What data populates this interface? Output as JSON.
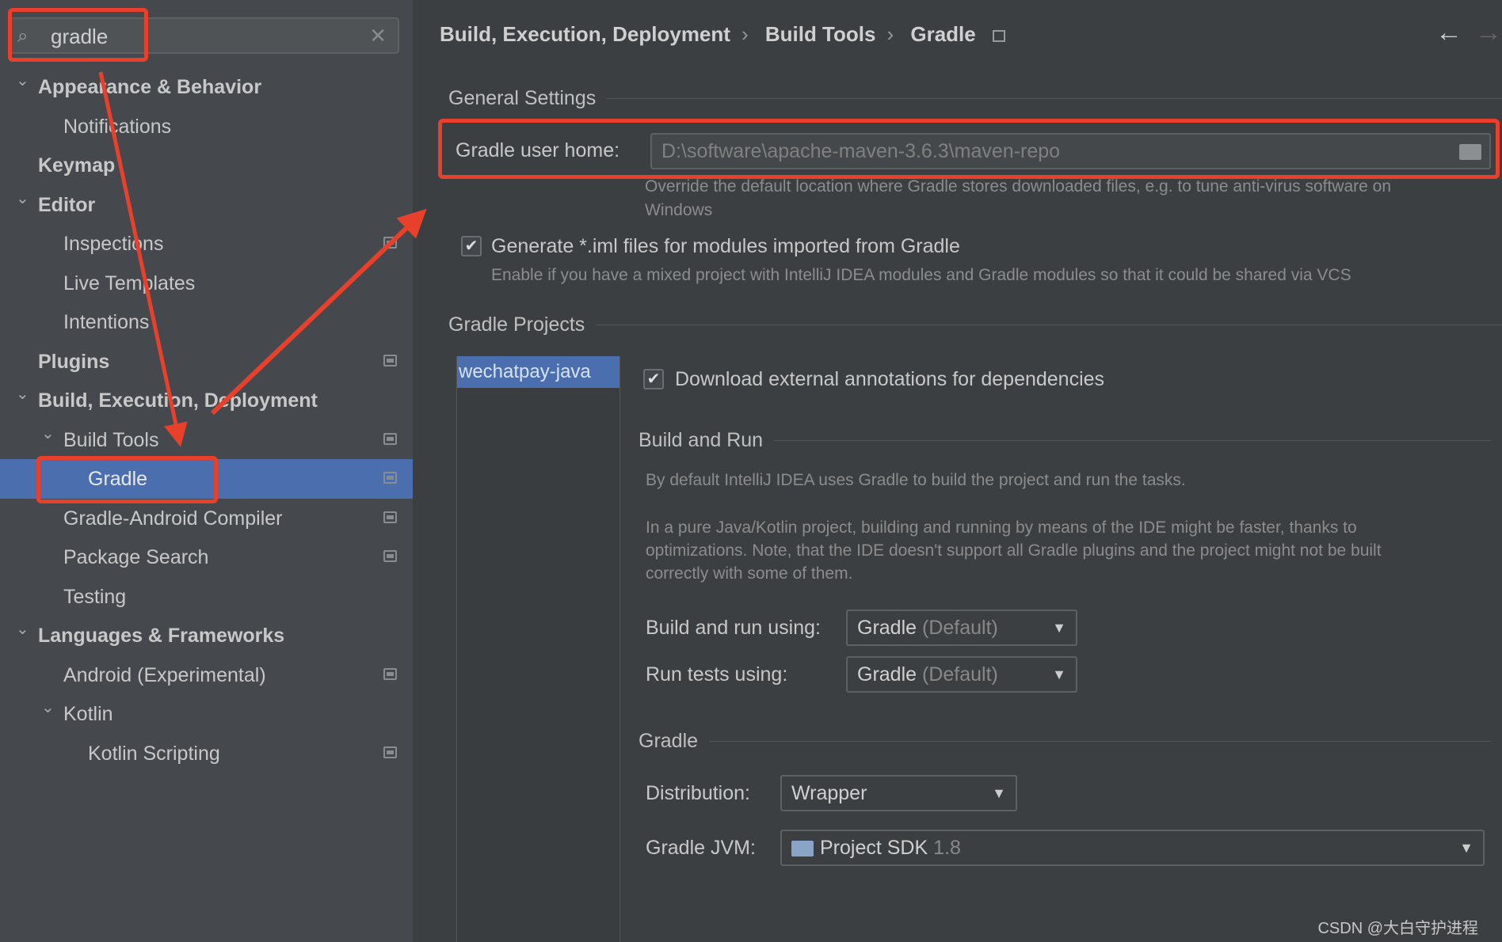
{
  "search": {
    "value": "gradle",
    "icon": "search-icon",
    "clear": "clear-icon"
  },
  "tree": [
    {
      "label": "Appearance & Behavior",
      "level": 0,
      "bold": true,
      "expanded": true
    },
    {
      "label": "Notifications",
      "level": 1
    },
    {
      "label": "Keymap",
      "level": 0,
      "bold": true
    },
    {
      "label": "Editor",
      "level": 0,
      "bold": true,
      "expanded": true
    },
    {
      "label": "Inspections",
      "level": 1,
      "cfg": true
    },
    {
      "label": "Live Templates",
      "level": 1
    },
    {
      "label": "Intentions",
      "level": 1
    },
    {
      "label": "Plugins",
      "level": 0,
      "bold": true,
      "cfg": true
    },
    {
      "label": "Build, Execution, Deployment",
      "level": 0,
      "bold": true,
      "expanded": true
    },
    {
      "label": "Build Tools",
      "level": 1,
      "expanded": true,
      "cfg": true
    },
    {
      "label": "Gradle",
      "level": 2,
      "selected": true,
      "cfg": true
    },
    {
      "label": "Gradle-Android Compiler",
      "level": 1,
      "cfg": true
    },
    {
      "label": "Package Search",
      "level": 1,
      "cfg": true
    },
    {
      "label": "Testing",
      "level": 1
    },
    {
      "label": "Languages & Frameworks",
      "level": 0,
      "bold": true,
      "expanded": true
    },
    {
      "label": "Android (Experimental)",
      "level": 1,
      "cfg": true
    },
    {
      "label": "Kotlin",
      "level": 1,
      "expanded": true
    },
    {
      "label": "Kotlin Scripting",
      "level": 2,
      "cfg": true
    }
  ],
  "breadcrumb": [
    "Build, Execution, Deployment",
    "Build Tools",
    "Gradle"
  ],
  "general": {
    "title": "General Settings",
    "user_home_label": "Gradle user home:",
    "user_home_value": "D:\\software\\apache-maven-3.6.3\\maven-repo",
    "user_home_hint1": "Override the default location where Gradle stores downloaded files, e.g. to tune anti-virus software on",
    "user_home_hint2": "Windows",
    "iml_label": "Generate *.iml files for modules imported from Gradle",
    "iml_checked": true,
    "iml_hint": "Enable if you have a mixed project with IntelliJ IDEA modules and Gradle modules so that it could be shared via VCS"
  },
  "projects": {
    "title": "Gradle Projects",
    "items": [
      "wechatpay-java"
    ],
    "download_label": "Download external annotations for dependencies",
    "download_checked": true,
    "build_run_title": "Build and Run",
    "para1": "By default IntelliJ IDEA uses Gradle to build the project and run the tasks.",
    "para2_1": "In a pure Java/Kotlin project, building and running by means of the IDE might be faster, thanks to",
    "para2_2": "optimizations. Note, that the IDE doesn't support all Gradle plugins and the project might not be built",
    "para2_3": "correctly with some of them.",
    "build_using_label": "Build and run using:",
    "build_using_value": "Gradle",
    "build_using_suffix": "(Default)",
    "tests_using_label": "Run tests using:",
    "tests_using_value": "Gradle",
    "tests_using_suffix": "(Default)",
    "gradle_title": "Gradle",
    "distribution_label": "Distribution:",
    "distribution_value": "Wrapper",
    "jvm_label": "Gradle JVM:",
    "jvm_value": "Project SDK",
    "jvm_version": "1.8"
  },
  "watermark": "CSDN @大白守护进程",
  "colors": {
    "selection": "#4b6eaf",
    "annotation": "#e8402a"
  }
}
